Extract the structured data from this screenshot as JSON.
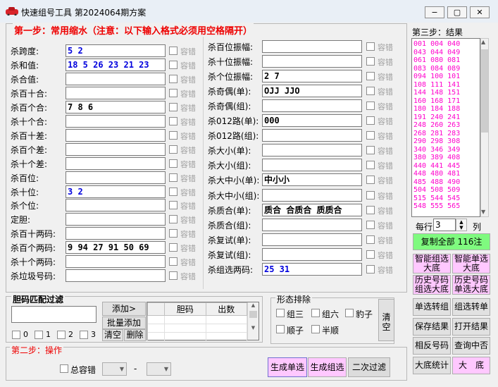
{
  "window": {
    "title": "快速组号工具   第2024064期方案",
    "minimize": "−",
    "maximize": "▢",
    "close": "✕"
  },
  "step1": {
    "title": "第一步：常用缩水（注意：以下输入格式必须用空格隔开）",
    "tolerance_label": "容错",
    "left_fields": [
      {
        "label": "杀跨度:",
        "value": "5 2"
      },
      {
        "label": "杀和值:",
        "value": "18 5 26 23 21 23"
      },
      {
        "label": "杀合值:",
        "value": ""
      },
      {
        "label": "杀百十合:",
        "value": ""
      },
      {
        "label": "杀百个合:",
        "value": "7 8 6"
      },
      {
        "label": "杀十个合:",
        "value": ""
      },
      {
        "label": "杀百十差:",
        "value": ""
      },
      {
        "label": "杀百个差:",
        "value": ""
      },
      {
        "label": "杀十个差:",
        "value": ""
      },
      {
        "label": "杀百位:",
        "value": ""
      },
      {
        "label": "杀十位:",
        "value": "3 2"
      },
      {
        "label": "杀个位:",
        "value": ""
      },
      {
        "label": "定胆:",
        "value": ""
      },
      {
        "label": "杀百十两码:",
        "value": ""
      },
      {
        "label": "杀百个两码:",
        "value": "9 94 27 91 50 69"
      },
      {
        "label": "杀十个两码:",
        "value": ""
      },
      {
        "label": "杀垃圾号码:",
        "value": ""
      }
    ],
    "right_fields": [
      {
        "label": "杀百位振幅:",
        "value": ""
      },
      {
        "label": "杀十位振幅:",
        "value": ""
      },
      {
        "label": "杀个位振幅:",
        "value": "2 7"
      },
      {
        "label": "杀奇偶(单):",
        "value": "OJJ JJO"
      },
      {
        "label": "杀奇偶(组):",
        "value": ""
      },
      {
        "label": "杀012路(单):",
        "value": "000"
      },
      {
        "label": "杀012路(组):",
        "value": ""
      },
      {
        "label": "杀大小(单):",
        "value": ""
      },
      {
        "label": "杀大小(组):",
        "value": ""
      },
      {
        "label": "杀大中小(单):",
        "value": "中小小"
      },
      {
        "label": "杀大中小(组):",
        "value": ""
      },
      {
        "label": "杀质合(单):",
        "value": "质合 合质合 质质合"
      },
      {
        "label": "杀质合(组):",
        "value": ""
      },
      {
        "label": "杀复试(单):",
        "value": ""
      },
      {
        "label": "杀复试(组):",
        "value": ""
      },
      {
        "label": "杀组选两码:",
        "value": "25 31"
      }
    ]
  },
  "step3": {
    "title": "第三步：结果",
    "results": [
      "001 004 040",
      "043 044 049",
      "061 080 081",
      "083 084 089",
      "094 100 101",
      "108 111 141",
      "144 148 151",
      "160 168 171",
      "180 184 188",
      "191 240 241",
      "248 260 263",
      "268 281 283",
      "290 298 308",
      "340 346 349",
      "380 389 408",
      "440 441 445",
      "448 480 481",
      "485 488 490",
      "504 508 509",
      "515 544 545",
      "548 555 565"
    ],
    "rows_label": "每行",
    "rows_value": "3",
    "cols_label": "列",
    "copy_button": "复制全部 116注",
    "buttons": [
      {
        "label": "智能组选\n大底",
        "style": "pink"
      },
      {
        "label": "智能单选\n大底",
        "style": "pink"
      },
      {
        "label": "历史号码\n组选大底",
        "style": "pink"
      },
      {
        "label": "历史号码\n单选大底",
        "style": "pink"
      },
      {
        "label": "单选转组",
        "style": "gray"
      },
      {
        "label": "组选转单",
        "style": "gray"
      },
      {
        "label": "保存结果",
        "style": "gray"
      },
      {
        "label": "打开结果",
        "style": "gray"
      },
      {
        "label": "相反号码",
        "style": "gray"
      },
      {
        "label": "查询中否",
        "style": "gray"
      },
      {
        "label": "大底统计",
        "style": "gray"
      },
      {
        "label": "大　底",
        "style": "pink"
      }
    ]
  },
  "filter": {
    "title": "胆码匹配过滤",
    "add_button": "添加>",
    "batch_button": "批量添加",
    "clear_button": "清空",
    "delete_button": "删除",
    "col_dan": "胆码",
    "col_count": "出数",
    "checks": [
      "0",
      "1",
      "2",
      "3"
    ]
  },
  "state": {
    "title": "形态排除",
    "options": [
      "组三",
      "组六",
      "豹子",
      "顺子",
      "半顺"
    ],
    "clear": "清\n空"
  },
  "step2": {
    "title": "第二步：操作",
    "total_tol": "总容错",
    "dash": "-",
    "gen_single": "生成单选",
    "gen_group": "生成组选",
    "second_filter": "二次过滤"
  }
}
